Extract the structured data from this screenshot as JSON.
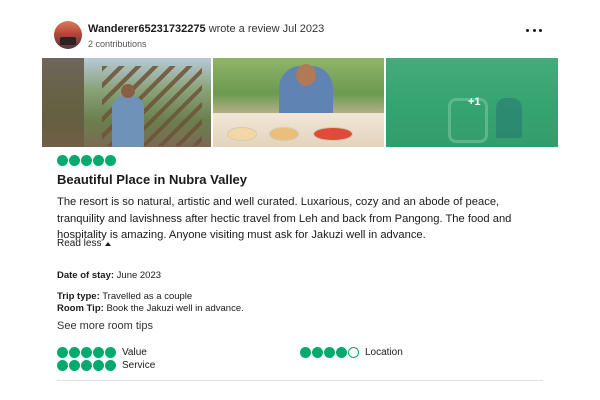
{
  "review": {
    "author": "Wanderer65231732275",
    "action": "wrote a review Jul 2023",
    "contributions": "2 contributions",
    "photos": [
      {
        "name": "photo-stairs-person"
      },
      {
        "name": "photo-dining"
      },
      {
        "name": "photo-garden",
        "overlay_count": "+1"
      }
    ],
    "rating": 5,
    "title": "Beautiful Place in Nubra Valley",
    "body": "The resort is so natural, artistic and well curated. Luxarious, cozy and an abode of peace, tranquility and lavishness after hectic travel from Leh and back from Pangong. The food and hospitality is amazing. Anyone visiting must ask for Jakuzi well in advance.",
    "read_less": "Read less",
    "date_label": "Date of stay:",
    "date_value": "June 2023",
    "trip_label": "Trip type:",
    "trip_value": "Travelled as a couple",
    "tip_label": "Room Tip:",
    "tip_value": "Book the Jakuzi well in advance.",
    "see_more_tips": "See more room tips",
    "sub_ratings": [
      {
        "label": "Value",
        "rating": 5
      },
      {
        "label": "Service",
        "rating": 5
      },
      {
        "label": "Location",
        "rating": 4
      }
    ]
  },
  "colors": {
    "accent": "#00aa6c",
    "text": "#1a1a1a"
  },
  "icons": {
    "more": "more-dots-icon",
    "collapse": "caret-up-icon"
  }
}
